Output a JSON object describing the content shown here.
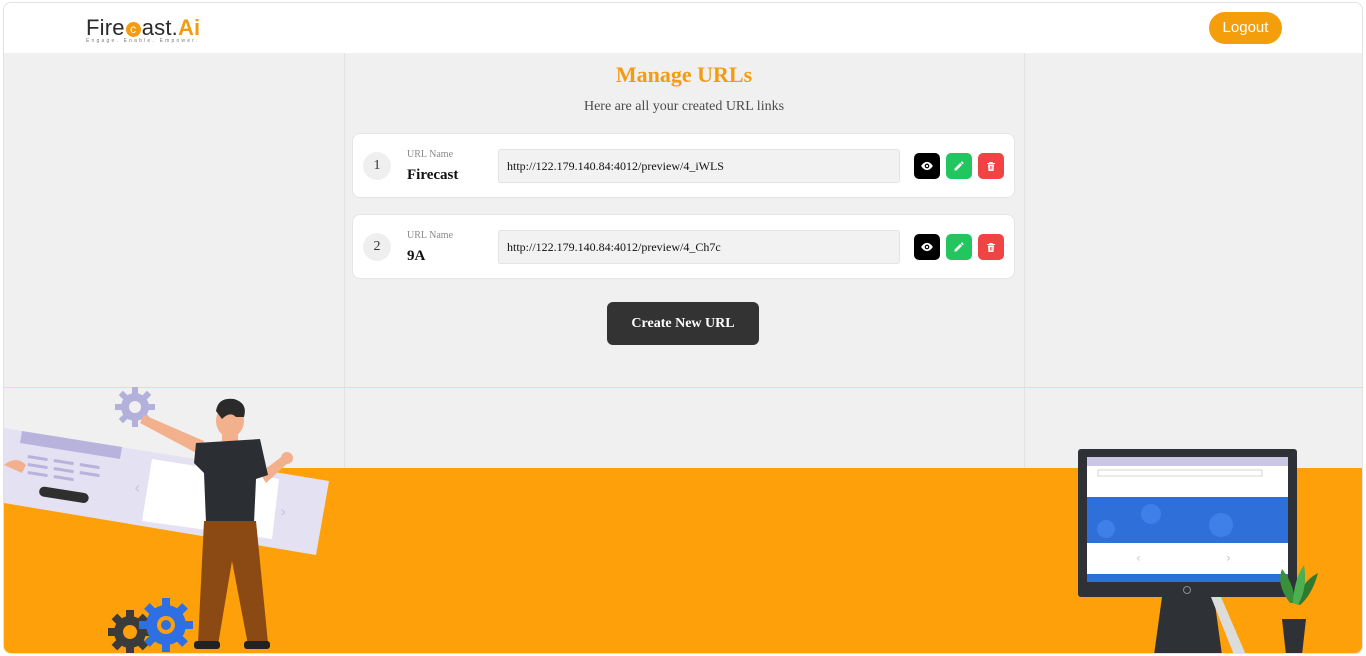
{
  "header": {
    "logo_text_fire": "Fire",
    "logo_text_c": "c",
    "logo_text_ast": "ast.",
    "logo_text_ai": "Ai",
    "logo_tagline": "Engage. Enable. Empower.",
    "logout_label": "Logout"
  },
  "main": {
    "title": "Manage URLs",
    "subtitle": "Here are all your created URL links",
    "url_name_label": "URL Name",
    "urls": [
      {
        "index": "1",
        "name": "Firecast",
        "url": "http://122.179.140.84:4012/preview/4_iWLS"
      },
      {
        "index": "2",
        "name": "9A",
        "url": "http://122.179.140.84:4012/preview/4_Ch7c"
      }
    ],
    "create_label": "Create New URL"
  },
  "icons": {
    "view": "eye-icon",
    "edit": "pencil-icon",
    "delete": "trash-icon"
  },
  "colors": {
    "accent": "#f39c12",
    "logout_bg": "#f59e0b",
    "view_btn": "#000000",
    "edit_btn": "#22c55e",
    "delete_btn": "#ef4444",
    "create_btn": "#333333",
    "footer_band": "#fea00a"
  }
}
